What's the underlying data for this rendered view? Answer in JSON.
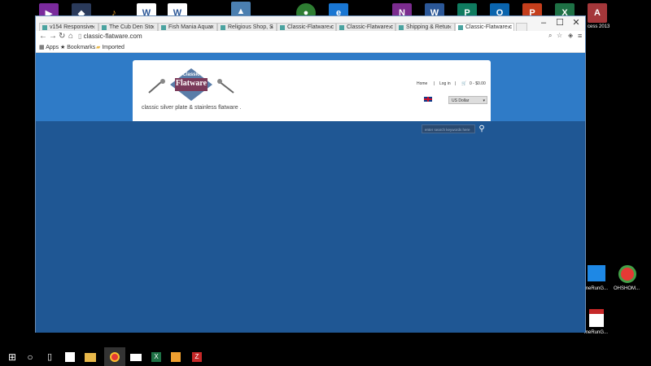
{
  "desktop": {
    "right_labels": [
      "cess 2013",
      "meRunG...",
      "OHSHOM...",
      "meRunG..."
    ]
  },
  "browser": {
    "tabs": [
      {
        "label": "v154 Responsive"
      },
      {
        "label": "The Cub Den Sto"
      },
      {
        "label": "Fish Mania Aquar"
      },
      {
        "label": "Religious Shop, S"
      },
      {
        "label": "Classic-Flatware.c"
      },
      {
        "label": "Classic-Flatware.c"
      },
      {
        "label": "Shipping & Retur"
      },
      {
        "label": "Classic-Flatware.c"
      }
    ],
    "address": "classic-flatware.com",
    "bookmarks": {
      "apps": "Apps",
      "bookmarks": "Bookmarks",
      "imported": "Imported"
    }
  },
  "site": {
    "logo_text": "Flatware",
    "logo_top": "Classic",
    "tagline": "classic silver plate & stainless flatware .",
    "nav": {
      "home": "Home",
      "sep1": "|",
      "login": "Log in",
      "sep2": "|",
      "cart": "0 - $0.00"
    },
    "currency": "US Dollar",
    "search_placeholder": "enter search keywords here"
  },
  "colors": {
    "band": "#2f7bc7",
    "page": "#1f5794"
  }
}
